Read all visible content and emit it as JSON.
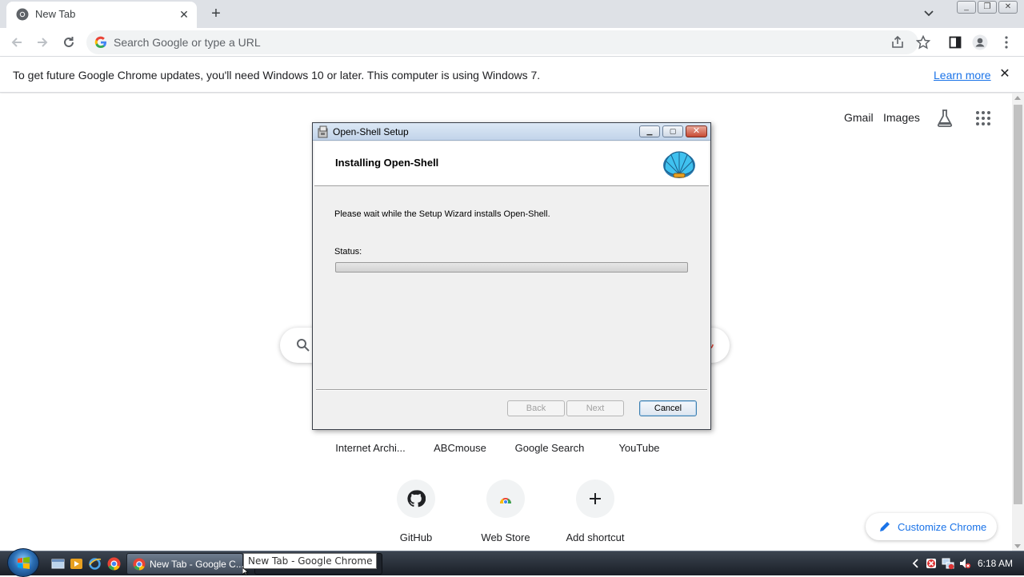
{
  "browser": {
    "tab_title": "New Tab",
    "omnibox_placeholder": "Search Google or type a URL"
  },
  "infobar": {
    "message": "To get future Google Chrome updates, you'll need Windows 10 or later. This computer is using Windows 7.",
    "learn_more": "Learn more"
  },
  "ntp": {
    "gmail": "Gmail",
    "images": "Images",
    "shortcuts_row1": [
      "Internet Archi...",
      "ABCmouse",
      "Google Search",
      "YouTube"
    ],
    "shortcuts_row2": [
      "GitHub",
      "Web Store",
      "Add shortcut"
    ],
    "customize": "Customize Chrome"
  },
  "dialog": {
    "title": "Open-Shell Setup",
    "heading": "Installing Open-Shell",
    "body": "Please wait while the Setup Wizard installs Open-Shell.",
    "status_label": "Status:",
    "progress": 0,
    "back": "Back",
    "next": "Next",
    "cancel": "Cancel"
  },
  "taskbar": {
    "task_label": "New Tab - Google C...",
    "tooltip": "New Tab - Google Chrome",
    "clock": "6:18 AM"
  },
  "colors": {
    "accent": "#1a73e8",
    "tabstrip": "#dee1e6",
    "dialog_bg": "#f0f0f0"
  },
  "icons": [
    "chrome-icon",
    "close-icon",
    "plus-icon",
    "chevron-down-icon",
    "back-icon",
    "forward-icon",
    "reload-icon",
    "google-g-icon",
    "share-icon",
    "star-icon",
    "side-panel-icon",
    "profile-icon",
    "menu-icon",
    "labs-icon",
    "apps-grid-icon",
    "search-icon",
    "mic-icon",
    "github-icon",
    "webstore-icon",
    "pencil-icon",
    "open-shell-logo-icon",
    "windows-flag-icon"
  ]
}
